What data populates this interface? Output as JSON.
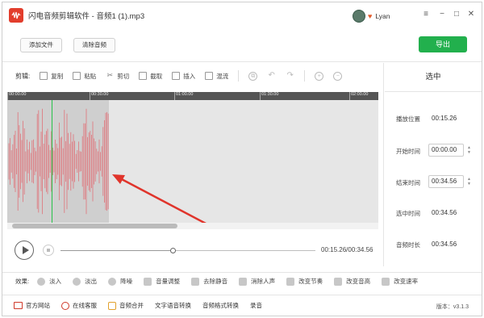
{
  "app": {
    "title": "闪电音频剪辑软件 - 音频1 (1).mp3",
    "username": "Lyan"
  },
  "window_controls": {
    "menu": "≡",
    "minimize": "−",
    "maximize": "□",
    "close": "✕"
  },
  "top_buttons": {
    "add_file": "添加文件",
    "clear_audio": "清除音频",
    "export": "导出"
  },
  "toolbar": {
    "label": "剪辑:",
    "tools": [
      "复制",
      "粘贴",
      "剪切",
      "截取",
      "插入",
      "混流"
    ]
  },
  "ruler_ticks": [
    "00:00.00",
    "00:30.00",
    "01:00.00",
    "01:30.00",
    "02:00.00"
  ],
  "player": {
    "time_readout": "00:15.26/00:34.56",
    "progress": 0.44
  },
  "right_panel": {
    "title": "选中",
    "play_position_label": "播放位置",
    "play_position_value": "00:15.26",
    "start_time_label": "开始时间",
    "start_time_value": "00:00.00",
    "end_time_label": "结束时间",
    "end_time_value": "00:34.56",
    "selected_time_label": "选中时间",
    "selected_time_value": "00:34.56",
    "duration_label": "音频时长",
    "duration_value": "00:34.56"
  },
  "effects": {
    "label": "效果:",
    "items": [
      "淡入",
      "淡出",
      "降噪",
      "音量调整",
      "去除静音",
      "消除人声",
      "改变节奏",
      "改变音高",
      "改变速率"
    ]
  },
  "bottom_bar": {
    "items": [
      "官方网站",
      "在线客服",
      "音频合并",
      "文字语音转换",
      "音频格式转换",
      "录音"
    ],
    "version": "版本：v3.1.3"
  },
  "colors": {
    "accent_green": "#22b04d",
    "waveform": "#e0737a",
    "brand_red": "#e23d2c",
    "playhead": "#29c24b",
    "arrow": "#e0342b"
  }
}
